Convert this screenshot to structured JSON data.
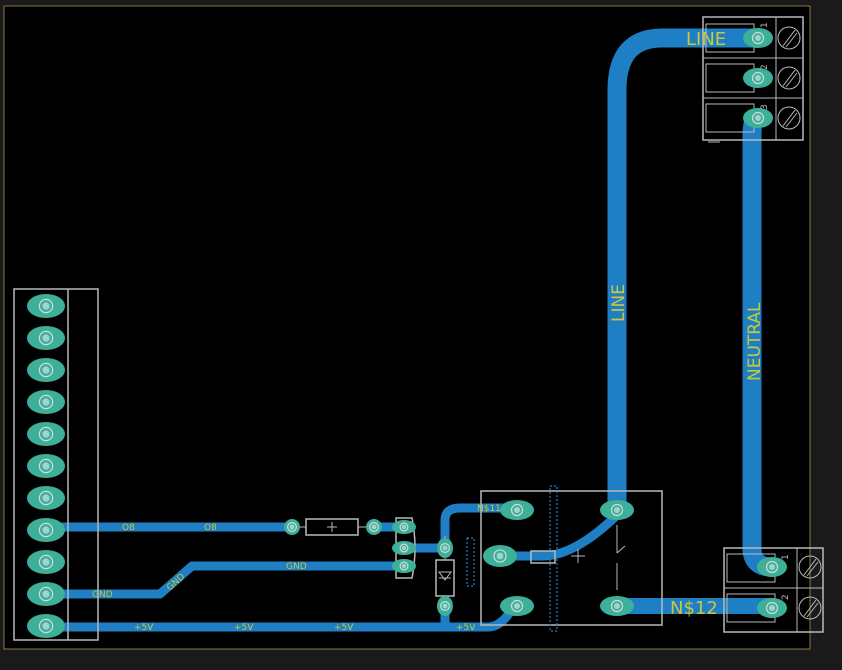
{
  "net_labels": {
    "line_top": "LINE",
    "line_vertical": "LINE",
    "neutral_vertical": "NEUTRAL",
    "n12": "N$12",
    "n11": "N$11",
    "o8_a": "O8",
    "o8_b": "O8",
    "gnd_a": "GND",
    "gnd_b": "GND",
    "gnd_c": "GND",
    "p5v_a": "+5V",
    "p5v_b": "+5V",
    "p5v_c": "+5V",
    "p5v_d": "+5V"
  },
  "terminal_pin_numbers": {
    "top": [
      "1",
      "2",
      "3"
    ],
    "bottom": [
      "1",
      "2"
    ]
  },
  "colors": {
    "background": "#000000",
    "trace": "#1f7fc4",
    "pad": "#3db09a",
    "silkscreen": "#b9b9b9",
    "label": "#c8c83c",
    "board_outline": "#8a7a3a"
  }
}
